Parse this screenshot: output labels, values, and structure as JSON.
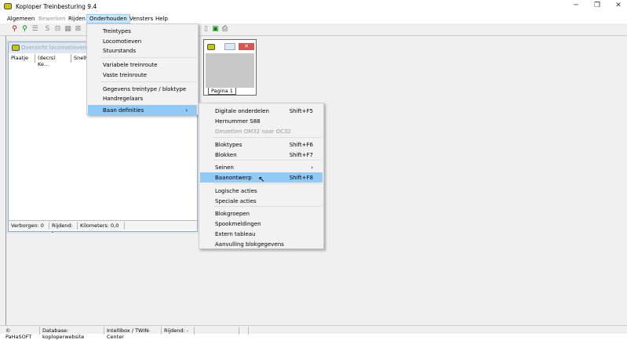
{
  "window": {
    "title": "Koploper Treinbesturing 9.4"
  },
  "menubar": [
    "Algemeen",
    "Bewerken",
    "Rijden",
    "Onderhouden",
    "Vensters",
    "Help"
  ],
  "onderhouden_menu": [
    "Treintypes",
    "Locomotieven",
    "Stuurstands",
    "Variabele treinroute",
    "Vaste treinroute",
    "Gegevens treintype / bloktype",
    "Handregelaars",
    "Baan definities"
  ],
  "baan_definities_menu": [
    {
      "label": "Digitale onderdelen",
      "shortcut": "Shift+F5"
    },
    {
      "label": "Hernummer S88",
      "shortcut": ""
    },
    {
      "label": "Omzetten OM32 naar OC32",
      "shortcut": "",
      "disabled": true
    },
    {
      "label": "Bloktypes",
      "shortcut": "Shift+F6"
    },
    {
      "label": "Blokken",
      "shortcut": "Shift+F7"
    },
    {
      "label": "Seinen",
      "shortcut": "",
      "submenu": true
    },
    {
      "label": "Baanontwerp",
      "shortcut": "Shift+F8",
      "highlighted": true
    },
    {
      "label": "Logische acties",
      "shortcut": ""
    },
    {
      "label": "Speciale acties",
      "shortcut": ""
    },
    {
      "label": "Blokgroepen",
      "shortcut": ""
    },
    {
      "label": "Spookmeldingen",
      "shortcut": ""
    },
    {
      "label": "Extern tableau",
      "shortcut": ""
    },
    {
      "label": "Aanvulling blokgegevens",
      "shortcut": ""
    }
  ],
  "loco_window": {
    "title": "Overzicht locomotieven",
    "columns": [
      "Plaatje",
      "(decrs) Ke...",
      "Snelhe"
    ],
    "status": [
      "Verborgen: 0",
      "Rijdend: -",
      "Kilometers:  0,0"
    ]
  },
  "small_window": {
    "tab": "Pagina 1"
  },
  "statusbar": [
    "© PaHaSOFT",
    "Database: koploperwebsite",
    "Intellibox / TWIN-Center",
    "Rijdend: -"
  ],
  "colors": {
    "highlight": "#91c9f7",
    "menu_open": "#cce8ff",
    "close_red": "#d9534f"
  }
}
